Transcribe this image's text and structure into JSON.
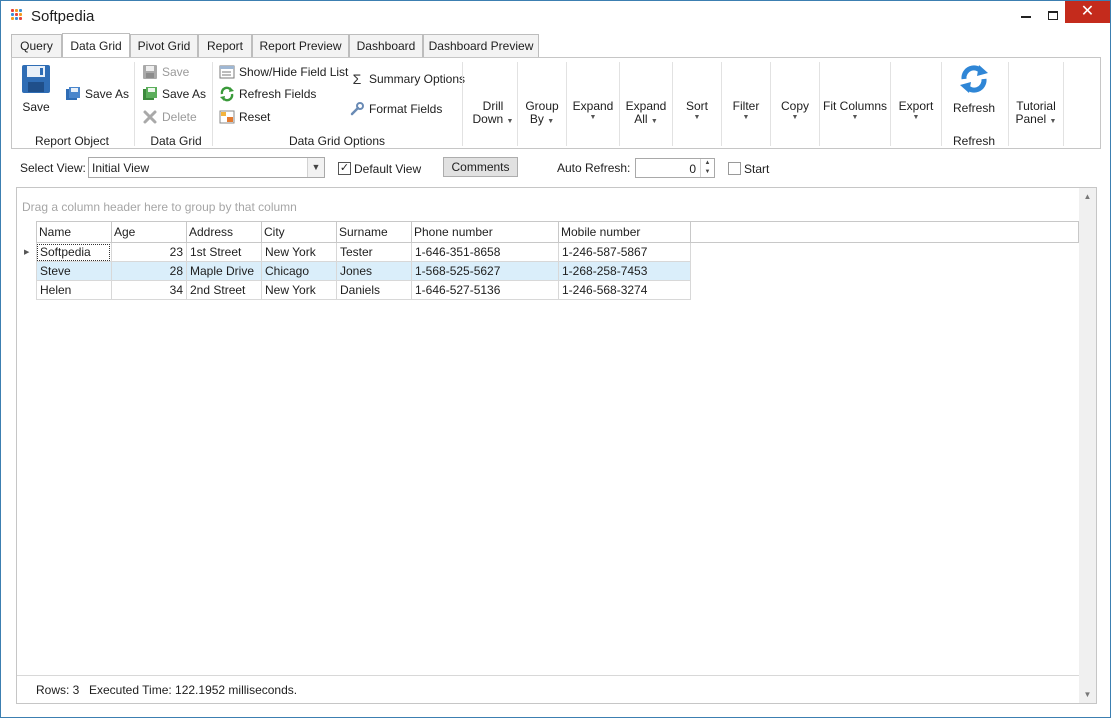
{
  "window": {
    "title": "Softpedia"
  },
  "tabs": [
    "Query",
    "Data Grid",
    "Pivot Grid",
    "Report",
    "Report Preview",
    "Dashboard",
    "Dashboard Preview"
  ],
  "active_tab": "Data Grid",
  "ribbon": {
    "report_object": {
      "label": "Report Object",
      "save": "Save",
      "save_as": "Save As"
    },
    "data_grid": {
      "label": "Data Grid",
      "save": "Save",
      "save_as": "Save As",
      "delete": "Delete"
    },
    "data_grid_options": {
      "label": "Data Grid Options",
      "show_hide": "Show/Hide Field List",
      "refresh_fields": "Refresh Fields",
      "reset": "Reset",
      "summary_options": "Summary Options",
      "format_fields": "Format Fields"
    },
    "dropdowns": [
      {
        "line1": "Drill",
        "line2": "Down"
      },
      {
        "line1": "Group",
        "line2": "By"
      },
      {
        "line1": "Expand",
        "line2": ""
      },
      {
        "line1": "Expand",
        "line2": "All"
      },
      {
        "line1": "Sort",
        "line2": ""
      },
      {
        "line1": "Filter",
        "line2": ""
      },
      {
        "line1": "Copy",
        "line2": ""
      },
      {
        "line1": "Fit Columns",
        "line2": ""
      },
      {
        "line1": "Export",
        "line2": ""
      }
    ],
    "refresh": {
      "label": "Refresh",
      "button": "Refresh"
    },
    "tutorial": {
      "line1": "Tutorial",
      "line2": "Panel"
    }
  },
  "toolbar": {
    "select_view_label": "Select View:",
    "select_view_value": "Initial View",
    "default_view_label": "Default View",
    "default_view_checked": true,
    "comments_button": "Comments",
    "auto_refresh_label": "Auto Refresh:",
    "auto_refresh_value": "0",
    "start_label": "Start",
    "start_checked": false
  },
  "grid": {
    "group_hint": "Drag a column header here to group by that column",
    "columns": [
      "Name",
      "Age",
      "Address",
      "City",
      "Surname",
      "Phone number",
      "Mobile number"
    ],
    "rows": [
      [
        "Softpedia",
        "23",
        "1st Street",
        "New York",
        "Tester",
        "1-646-351-8658",
        "1-246-587-5867"
      ],
      [
        "Steve",
        "28",
        "Maple Drive",
        "Chicago",
        "Jones",
        "1-568-525-5627",
        "1-268-258-7453"
      ],
      [
        "Helen",
        "34",
        "2nd Street",
        "New York",
        "Daniels",
        "1-646-527-5136",
        "1-246-568-3274"
      ]
    ],
    "selected_row": 1
  },
  "status": {
    "rows": "Rows: 3",
    "executed": "Executed Time: 122.1952 milliseconds."
  },
  "colors": {
    "selection": "#daeefa",
    "close_button": "#c42b1c",
    "border_accent": "#3c7fb1"
  }
}
